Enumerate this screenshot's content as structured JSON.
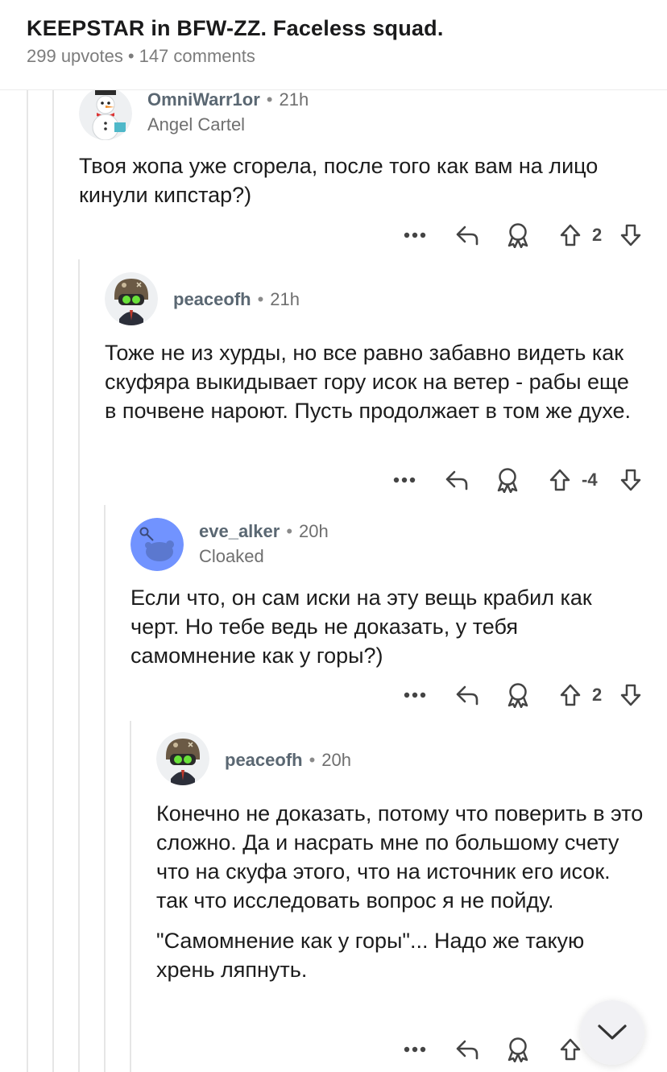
{
  "post": {
    "title": "KEEPSTAR in BFW-ZZ. Faceless squad.",
    "upvotes": "299 upvotes",
    "separator": "•",
    "comments": "147 comments"
  },
  "comments": [
    {
      "author": "OmniWarr1or",
      "age": "21h",
      "flair": "Angel Cartel",
      "avatar": "snowman-avatar",
      "paragraphs": [
        "Твоя жопа уже сгорела, после того как вам на лицо кинули кипстар?)"
      ],
      "score": "2"
    },
    {
      "author": "peaceofh",
      "age": "21h",
      "flair": "",
      "avatar": "helmet-avatar",
      "paragraphs": [
        "Тоже не из хурды, но все равно забавно видеть как скуфяра выкидывает гору исок на ветер - рабы еще в почвене нароют. Пусть продолжает в том же духе."
      ],
      "score": "-4"
    },
    {
      "author": "eve_alker",
      "age": "20h",
      "flair": "Cloaked",
      "avatar": "default-snoo-avatar",
      "paragraphs": [
        "Если что, он сам иски на эту вещь крабил как черт. Но тебе ведь не доказать, у тебя самомнение как у горы?)"
      ],
      "score": "2"
    },
    {
      "author": "peaceofh",
      "age": "20h",
      "flair": "",
      "avatar": "helmet-avatar",
      "paragraphs": [
        "Конечно не доказать, потому что поверить в это сложно. Да и насрать мне по большому счету что на скуфа этого, что на источник его исок. так что исследовать вопрос я не пойду.",
        "\"Самомнение как у горы\"... Надо же такую хрень ляпнуть."
      ],
      "score": ""
    }
  ],
  "icons": {
    "more": "more-options-icon",
    "reply": "reply-icon",
    "award": "award-icon",
    "upvote": "upvote-arrow-icon",
    "downvote": "downvote-arrow-icon",
    "scroll": "chevron-down-icon"
  },
  "colors": {
    "text": "#1c1c1c",
    "meta": "#7c7c7c",
    "thread_line": "#e6e6e6",
    "snoo_blue": "#7193ff"
  }
}
